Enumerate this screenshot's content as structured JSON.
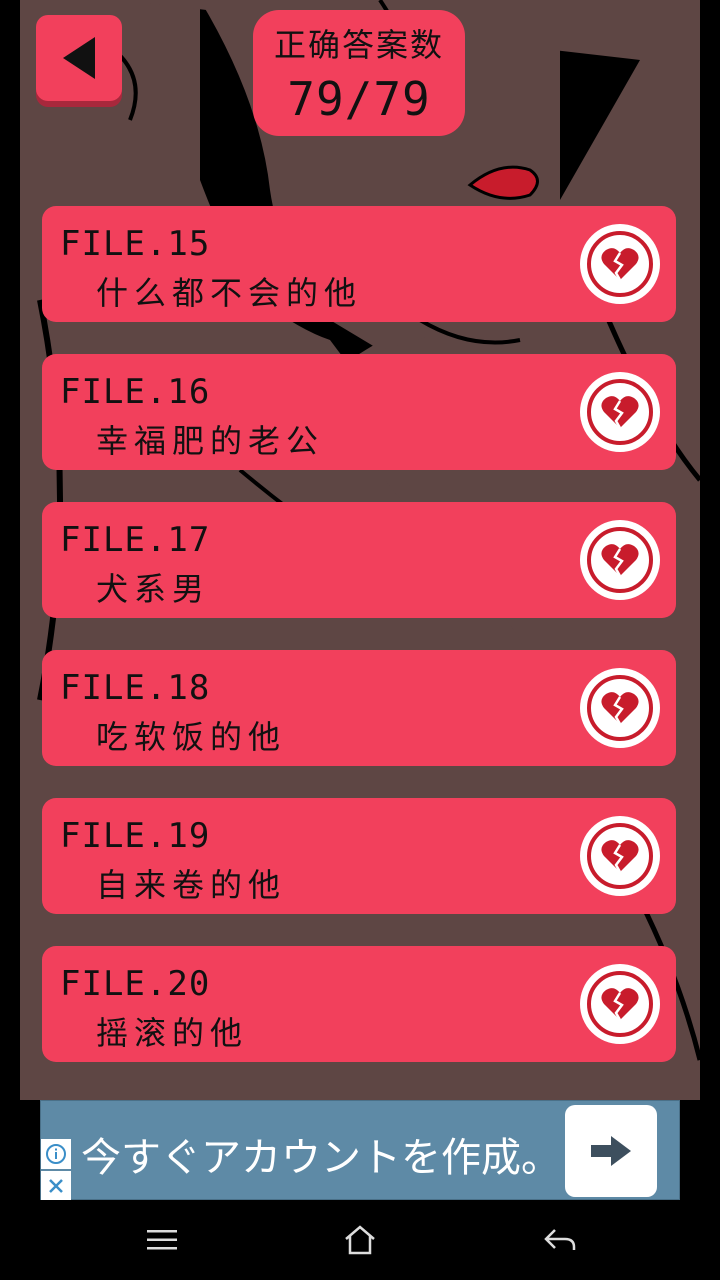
{
  "header": {
    "score_label": "正确答案数",
    "score_value": "79/79"
  },
  "files": [
    {
      "number": "FILE.15",
      "title": "什么都不会的他"
    },
    {
      "number": "FILE.16",
      "title": "幸福肥的老公"
    },
    {
      "number": "FILE.17",
      "title": "犬系男"
    },
    {
      "number": "FILE.18",
      "title": "吃软饭的他"
    },
    {
      "number": "FILE.19",
      "title": "自来卷的他"
    },
    {
      "number": "FILE.20",
      "title": "摇滚的他"
    }
  ],
  "ad": {
    "text": "今すぐアカウントを作成。",
    "button_icon": "arrow-right-icon"
  },
  "colors": {
    "accent": "#f2405c",
    "heart": "#c81c2c",
    "background_art": "#5e4644"
  },
  "navigation": {
    "items": [
      "menu-icon",
      "home-icon",
      "back-arrow-icon"
    ]
  }
}
